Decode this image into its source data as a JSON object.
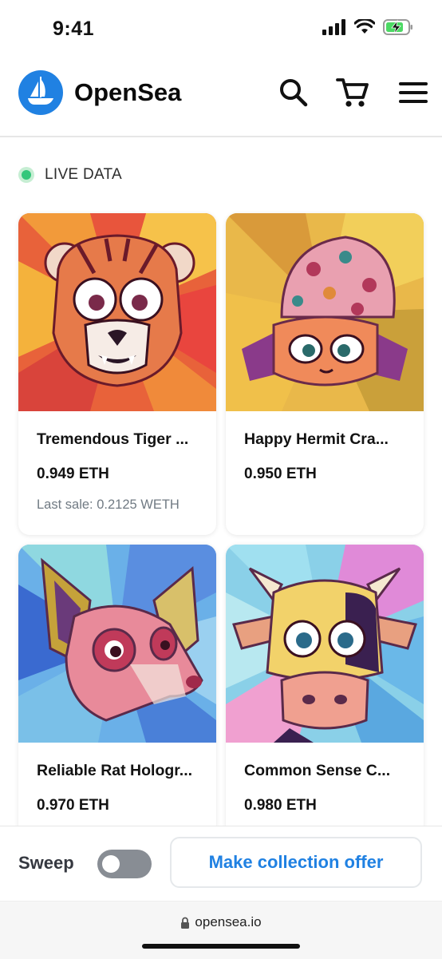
{
  "status_bar": {
    "time": "9:41",
    "icons": [
      "signal-icon",
      "wifi-icon",
      "battery-charging-icon"
    ]
  },
  "header": {
    "brand": "OpenSea",
    "logo_icon": "opensea-boat-logo",
    "actions": [
      "search-icon",
      "cart-icon",
      "menu-icon"
    ]
  },
  "live": {
    "label": "LIVE DATA",
    "color": "#34c77b"
  },
  "items": [
    {
      "name": "Tremendous Tiger ...",
      "price": "0.949 ETH",
      "last_sale": "Last sale: 0.2125 WETH"
    },
    {
      "name": "Happy Hermit Cra...",
      "price": "0.950 ETH",
      "last_sale": ""
    },
    {
      "name": "Reliable Rat Hologr...",
      "price": "0.970 ETH",
      "last_sale": ""
    },
    {
      "name": "Common Sense C...",
      "price": "0.980 ETH",
      "last_sale": ""
    }
  ],
  "bottom_bar": {
    "sweep_label": "Sweep",
    "sweep_on": false,
    "offer_button": "Make collection offer"
  },
  "url_bar": {
    "url": "opensea.io",
    "lock_icon": "lock-icon"
  },
  "colors": {
    "accent": "#2081e2",
    "text": "#121212",
    "muted": "#707a83"
  }
}
